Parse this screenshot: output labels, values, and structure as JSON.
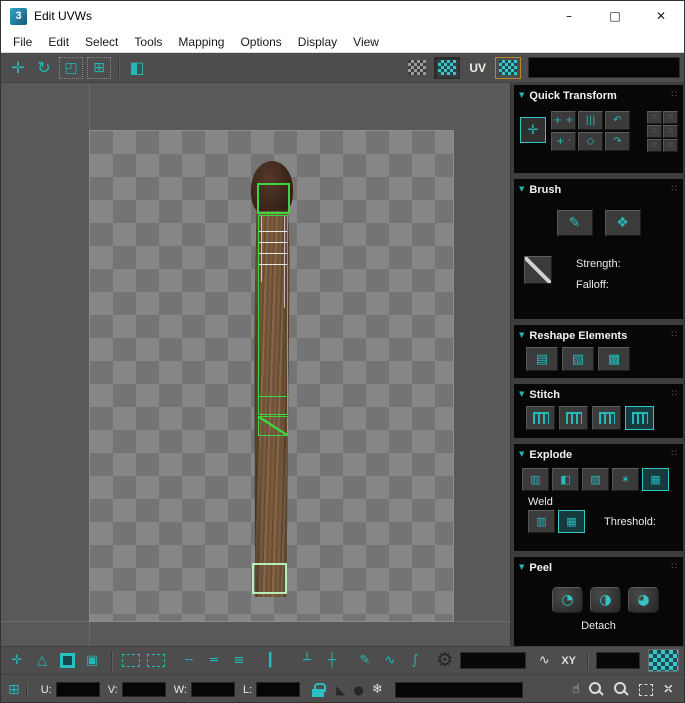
{
  "window": {
    "icon_label": "3",
    "title": "Edit UVWs",
    "minimize": "–",
    "maximize": "□",
    "close": "✕"
  },
  "menu_bar": {
    "items": [
      "File",
      "Edit",
      "Select",
      "Tools",
      "Mapping",
      "Options",
      "Display",
      "View"
    ]
  },
  "toolbar": {
    "uv_label": "UV"
  },
  "sidebar": {
    "quick_transform": {
      "title": "Quick Transform"
    },
    "brush": {
      "title": "Brush",
      "strength_label": "Strength:",
      "falloff_label": "Falloff:"
    },
    "reshape": {
      "title": "Reshape Elements"
    },
    "stitch": {
      "title": "Stitch"
    },
    "explode": {
      "title": "Explode",
      "weld_label": "Weld",
      "threshold_label": "Threshold:"
    },
    "peel": {
      "title": "Peel",
      "detach_label": "Detach"
    }
  },
  "bottom_toolbar": {
    "xy_label": "XY"
  },
  "status_bar": {
    "u_label": "U:",
    "v_label": "V:",
    "w_label": "W:",
    "l_label": "L:"
  },
  "icons": {
    "collapse_arrow": "▼",
    "grip": "∷",
    "move": "✛",
    "rotate": "↻",
    "scale": "◰",
    "freeform": "⊞",
    "mirror": "◧",
    "qt_move": "✛",
    "qt_cell_1": "+ +",
    "qt_cell_2": "|||",
    "qt_cell_3": "↶",
    "qt_cell_4": "+ ·",
    "qt_cell_5": "◇",
    "qt_cell_6": "↷",
    "qt_tiny": "∷",
    "brush_paint": "✎",
    "brush_relax": "❖",
    "reshape_1": "▤",
    "reshape_2": "▧",
    "reshape_3": "▩",
    "explode_1": "▥",
    "explode_2": "◧",
    "explode_3": "▨",
    "explode_4": "✶",
    "explode_5": "▦",
    "weld_1": "▥",
    "weld_2": "▦",
    "peel_1": "◔",
    "peel_2": "◑",
    "peel_3": "◕",
    "bt_typein": "✛",
    "bt_vertex": "△",
    "bt_cube": "▣",
    "bt_dash_1": "╌",
    "bt_dash_2": "═",
    "bt_dash_3": "≡",
    "bt_bar": "▎",
    "bt_tee": "┴",
    "bt_cross": "┼",
    "bt_brush": "✎",
    "bt_wave": "∿",
    "bt_integral": "∫",
    "bt_gear": "⚙",
    "bt_spline": "∿",
    "sb_gizmo": "⊞",
    "sb_triangle": "◣",
    "sb_dot": "●",
    "sb_snowflake": "❄",
    "sb_hand": "☝",
    "sb_arrows": "✛"
  },
  "colors": {
    "accent_teal": "#25b6b6",
    "uv_edge_green": "#3fd43f",
    "selected_edge_light": "#b7eeb7",
    "panel_bg": "#070707",
    "chrome_bg": "#4d4d4d",
    "canvas_bg": "#595959",
    "stick_brown": "#74563a",
    "match_head_brown": "#3b2619"
  }
}
